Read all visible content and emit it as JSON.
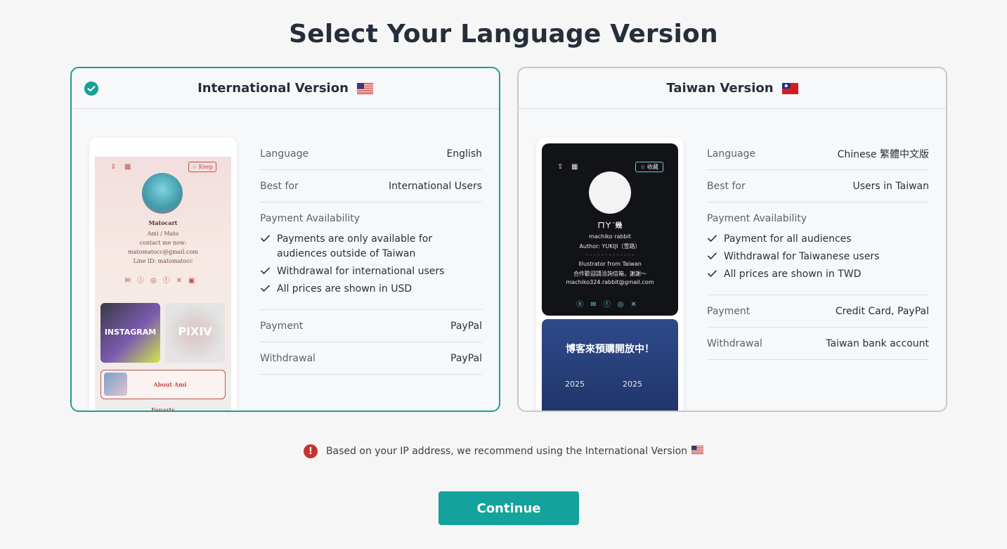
{
  "page": {
    "title": "Select Your Language Version"
  },
  "international": {
    "name": "International Version",
    "selected": true,
    "preview": {
      "keep_label": "Keep",
      "profile_name": "Matocart",
      "lines": [
        "Ami / Mato",
        "contact me now:",
        "matomatocc@gmail.com",
        "Line ID: matomatocc"
      ],
      "tile_instagram": "INSTAGRAM",
      "tile_pixiv": "PIXIV",
      "about_label": "About Ami",
      "fanarts_label": "Fanarts"
    },
    "language_label": "Language",
    "language_value": "English",
    "bestfor_label": "Best for",
    "bestfor_value": "International Users",
    "payment_availability_label": "Payment Availability",
    "availability": [
      "Payments are only available for audiences outside of Taiwan",
      "Withdrawal for international users",
      "All prices are shown in USD"
    ],
    "payment_label": "Payment",
    "payment_value": "PayPal",
    "withdrawal_label": "Withdrawal",
    "withdrawal_value": "PayPal"
  },
  "taiwan": {
    "name": "Taiwan Version",
    "selected": false,
    "preview": {
      "keep_label": "收藏",
      "profile_name": "ㄇㄚˊ幾",
      "lines": [
        "machiko rabbit",
        "Author: YUKIJI（雪路）",
        "- - - - - - - - - - - - -",
        "Illustrator from Taiwan",
        "合作歡迎請洽詢信箱，謝謝～",
        "machiko324.rabbit@gmail.com"
      ],
      "poster_title": "博客來預購開放中！",
      "poster_year_1": "2025",
      "poster_year_2": "2025"
    },
    "language_label": "Language",
    "language_value": "Chinese 繁體中文版",
    "bestfor_label": "Best for",
    "bestfor_value": "Users in Taiwan",
    "payment_availability_label": "Payment Availability",
    "availability": [
      "Payment for all audiences",
      "Withdrawal for Taiwanese users",
      "All prices are shown in TWD"
    ],
    "payment_label": "Payment",
    "payment_value": "Credit Card, PayPal",
    "withdrawal_label": "Withdrawal",
    "withdrawal_value": "Taiwan bank account"
  },
  "notice": {
    "text": "Based on your IP address, we recommend using the International Version"
  },
  "continue_label": "Continue",
  "colors": {
    "accent": "#13a39c",
    "alert": "#c2362f",
    "title": "#262e3a"
  }
}
